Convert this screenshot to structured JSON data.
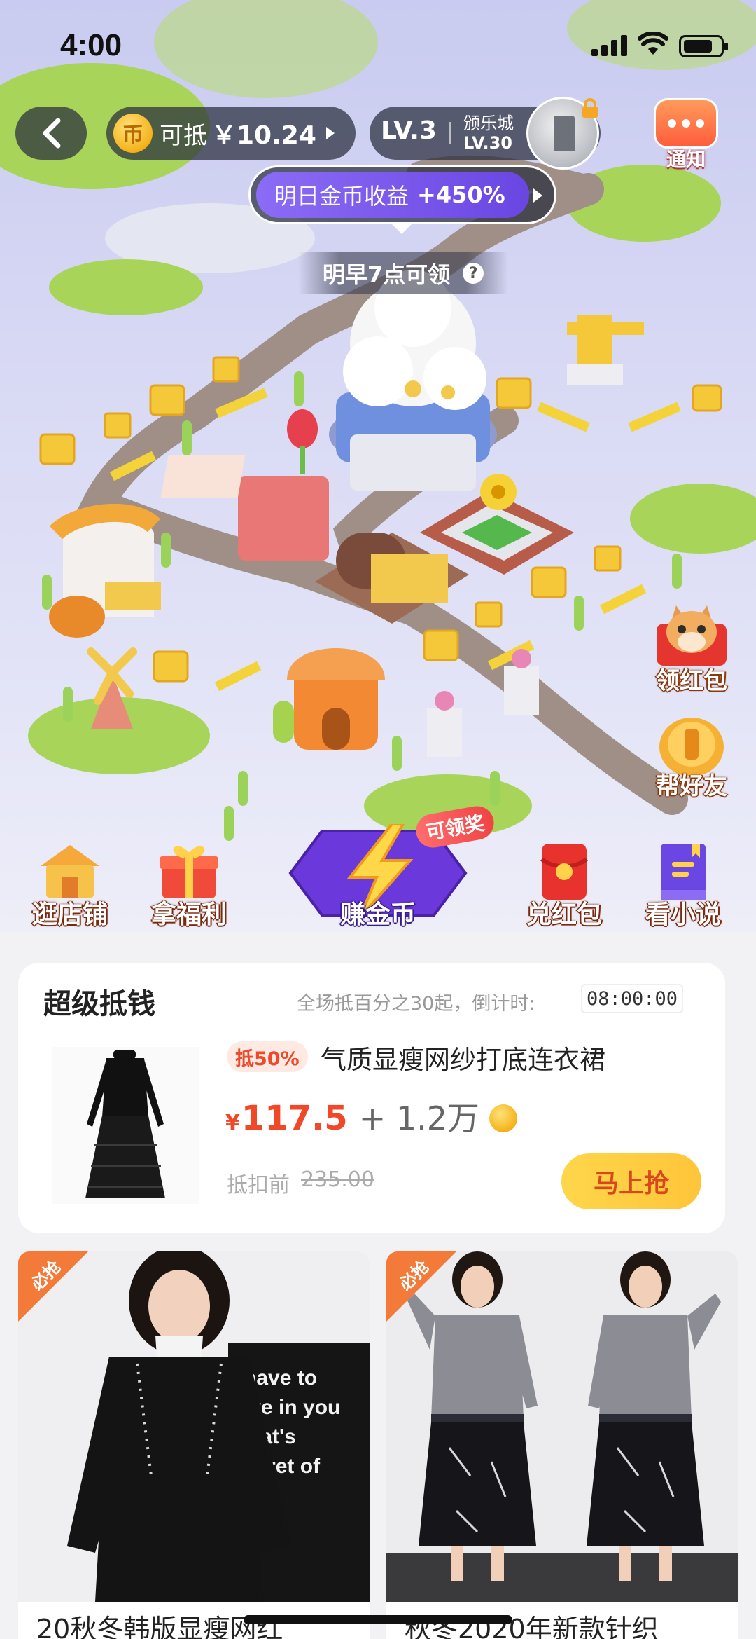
{
  "status_bar": {
    "time": "4:00"
  },
  "header": {
    "coin_label": "可抵",
    "coin_amount": "￥10.24",
    "coin_symbol": "币",
    "level": "LV.3",
    "next_city": "颁乐城",
    "next_level": "LV.30",
    "notify_label": "通知"
  },
  "bonus": {
    "text": "明日金币收益",
    "value": "+450%",
    "claim_time": "明早7点可领",
    "help": "?"
  },
  "side_buttons": [
    {
      "label": "领红包",
      "icon": "cat-icon"
    },
    {
      "label": "帮好友",
      "icon": "coin-stack-icon"
    }
  ],
  "nav": [
    {
      "label": "逛店铺",
      "icon": "shop-icon"
    },
    {
      "label": "拿福利",
      "icon": "gift-icon"
    },
    {
      "label": "赚金币",
      "icon": "lightning-icon",
      "badge": "可领奖"
    },
    {
      "label": "兑红包",
      "icon": "red-envelope-icon"
    },
    {
      "label": "看小说",
      "icon": "book-icon"
    }
  ],
  "deal": {
    "title": "超级抵钱",
    "countdown_label": "全场抵百分之30起，倒计时:",
    "countdown": "08:00:00",
    "discount_tag": "抵50%",
    "product_name": "气质显瘦网纱打底连衣裙",
    "price_symbol": "¥",
    "price": "117.5",
    "coins": "+ 1.2万",
    "original_label": "抵扣前",
    "original_price": "235.00",
    "buy_label": "马上抢"
  },
  "products": [
    {
      "ribbon": "必抢",
      "title": "20秋冬韩版显瘦网红",
      "shirt_text": "have to | ove in you | that's | secret of | cess"
    },
    {
      "ribbon": "必抢",
      "title": "秋冬2020年新款针织"
    }
  ],
  "colors": {
    "accent_purple": "#6a46e2",
    "price_red": "#f0492a",
    "buy_yellow": "#ffc53a",
    "tag_orange": "#f47a3a"
  }
}
